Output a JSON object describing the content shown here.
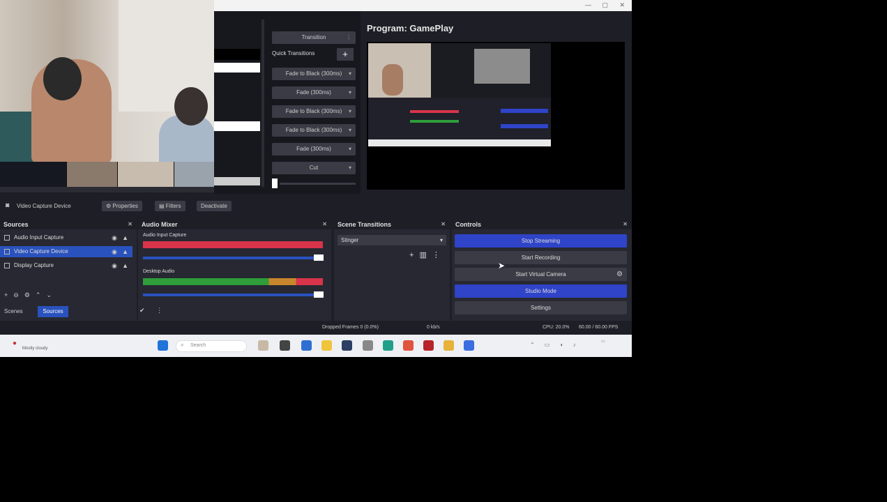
{
  "program": {
    "label": "Program: GamePlay"
  },
  "transitions_column": {
    "top_button": "Transition",
    "quick_transitions_label": "Quick Transitions",
    "items": [
      "Fade to Black (300ms)",
      "Fade (300ms)",
      "Fade to Black (300ms)",
      "Fade to Black (300ms)",
      "Fade (300ms)",
      "Cut"
    ]
  },
  "source_toolbar": {
    "current_source": "Video Capture Device",
    "properties": "Properties",
    "filters": "Filters",
    "deactivate": "Deactivate"
  },
  "sources": {
    "title": "Sources",
    "items": [
      {
        "label": "Audio Input Capture",
        "selected": false
      },
      {
        "label": "Video Capture Device",
        "selected": true
      },
      {
        "label": "Display Capture",
        "selected": false
      }
    ],
    "bottom_left": "Scenes",
    "bottom_right": "Sources"
  },
  "audio_mixer": {
    "title": "Audio Mixer",
    "channels": [
      {
        "name": "Audio Input Capture",
        "level_color": "#d9344a"
      },
      {
        "name": "Desktop Audio",
        "level_color": "#2e9d3a"
      }
    ]
  },
  "scene_transitions": {
    "title": "Scene Transitions",
    "selected": "Stinger"
  },
  "controls": {
    "title": "Controls",
    "buttons": [
      {
        "label": "Stop Streaming",
        "style": "blue"
      },
      {
        "label": "Start Recording",
        "style": "gray"
      },
      {
        "label": "Start Virtual Camera",
        "style": "gray"
      },
      {
        "label": "Studio Mode",
        "style": "blue"
      },
      {
        "label": "Settings",
        "style": "gray"
      }
    ]
  },
  "status": {
    "dropped": "Dropped Frames 0 (0.0%)",
    "bitrate": "0 kb/s",
    "cpu": "CPU: 20.0%",
    "fps": "60.00 / 60.00 FPS"
  },
  "taskbar": {
    "search_placeholder": "Search",
    "weather": "Mostly cloudy"
  },
  "colors": {
    "accent": "#2a52be",
    "stream_blue": "#2f44c9"
  }
}
